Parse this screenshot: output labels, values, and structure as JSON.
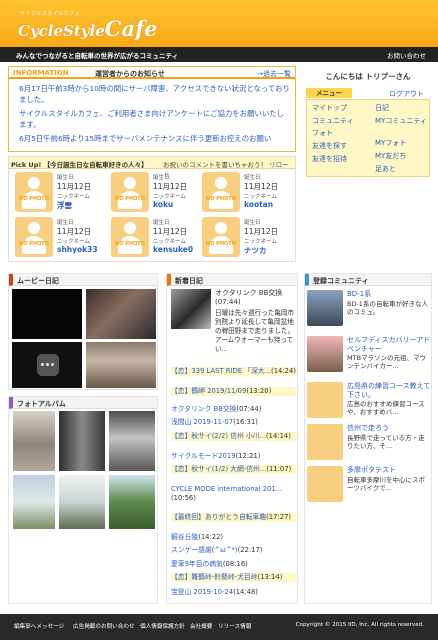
{
  "header": {
    "logo_small": "サイクルスタイルカフェ",
    "logo_main": "CycleStyle",
    "logo_cafe": "Cafe",
    "tagline": "みんなでつながると自転車の世界が広がるコミュニティ",
    "contact": "お問い合わせ"
  },
  "info": {
    "title_en": "INFORMATION",
    "title_ja": "運営者からのお知らせ",
    "past": "→過去一覧",
    "items": [
      "6月17日午前3時から10時の間にサーバ障害、アクセスできない状況となっておりました。",
      "サイクルスタイルカフェ、ご利用者さま向けアンケートにご協力をお願いいたします。",
      "6月5日午前6時より15時までサーバメンテナンスに伴う更新お控えのお願い"
    ]
  },
  "pickup": {
    "title": "Pick Up! 【今日誕生日な自転車好きの人々】",
    "bang": "お祝いのコメントを書いちゃおう！",
    "reload": "リロード",
    "birthday_label": "誕生日",
    "nickname_label": "ニックネーム",
    "no_photo": "NO PHOTO",
    "people": [
      {
        "date": "11月12日",
        "name": "浮雲"
      },
      {
        "date": "11月12日",
        "name": "koku"
      },
      {
        "date": "11月12日",
        "name": "kootan"
      },
      {
        "date": "11月12日",
        "name": "shhyok33"
      },
      {
        "date": "11月12日",
        "name": "kensuke0"
      },
      {
        "date": "11月12日",
        "name": "ナツカ"
      }
    ]
  },
  "sidebar": {
    "greeting": "こんにちは トリプーさん",
    "menu_label": "メニュー",
    "logout": "ログアウト",
    "left": [
      "マイトップ",
      "コミュニティ",
      "フォト",
      "友達を探す",
      "友達を招待"
    ],
    "right": [
      "日記",
      "MYコミュニティ",
      "MYフォト",
      "MY友だち",
      "足あと"
    ]
  },
  "movie": {
    "title": "ムービー日記"
  },
  "photo": {
    "title": "フォトアルバム"
  },
  "diary": {
    "title": "新着日記",
    "feature_title": "オクタリンク BB交換(07:44)",
    "feature_text": "日曜は先々週行った亀岡市別院より延長して亀岡盆地の稗田野まで走りました。アームウオーマーも持ってい...",
    "entries": [
      {
        "prefix": "【恋】",
        "text": "339 LAST RIDE 「深大...",
        "time": "(14:24)"
      },
      {
        "prefix": "【恋】",
        "text": "鶴岬 2019/11/09",
        "time": "(13:20)"
      },
      {
        "prefix": "",
        "text": "オクタリンク BB交換",
        "time": "(07:44)"
      },
      {
        "prefix": "",
        "text": "浅間山 2019-11-07",
        "time": "(16:31)"
      },
      {
        "prefix": "【恋】",
        "text": "秋サイ(2/2) 信州 小川...",
        "time": "(14:14)"
      },
      {
        "prefix": "",
        "text": "サイクルモード2019",
        "time": "(12:21)"
      },
      {
        "prefix": "【恋】",
        "text": "秋サイ(1/2) 大網-信州...",
        "time": "(11:07)"
      },
      {
        "prefix": "",
        "text": "CYCLE MODE international 201...",
        "time": "(10:56)"
      },
      {
        "prefix": "【最終回】",
        "text": "ありがとう自転車趣",
        "time": "(17:27)"
      },
      {
        "prefix": "",
        "text": "観谷丘陵",
        "time": "(14:22)"
      },
      {
        "prefix": "",
        "text": "スンゲー感謝(^ω^*)",
        "time": "(22:17)"
      },
      {
        "prefix": "",
        "text": "愛車9年目の病気",
        "time": "(08:16)"
      },
      {
        "prefix": "【恋】",
        "text": "難鶴峠-鈴懸峠-犬目峠",
        "time": "(13:14)"
      },
      {
        "prefix": "",
        "text": "宝登山 2019-10-24",
        "time": "(14:48)"
      }
    ]
  },
  "community": {
    "title": "登録コミュニティ",
    "items": [
      {
        "name": "BD-1系",
        "desc": "BD-1系の自転車が好きな人のコミュ。"
      },
      {
        "name": "セルフディスカバリーアドベンチャー",
        "desc": "MTBマラソンの元祖、マウンテンバイカー..."
      },
      {
        "name": "広島県の練習コース教えて下さい。",
        "desc": "広島のおすすめ練習コースや、おすすめバ..."
      },
      {
        "name": "信州で走ろう",
        "desc": "長野県で走っている方・走りたい方、そ..."
      },
      {
        "name": "多摩ポタテスト",
        "desc": "自転車多摩川を中心にスポーツバイクで..."
      }
    ]
  },
  "footer": {
    "links": [
      "編集部へメッセージ",
      "広告掲載のお問い合わせ",
      "個人情報保護方針",
      "会社概要",
      "リリース情報"
    ],
    "copyright": "Copyright © 2015 IID, Inc. All rights reserved."
  },
  "colors": {
    "brand_orange": "#f6a10f",
    "link_blue": "#2a5cc2",
    "menu_yellow": "#fff8c6",
    "footer_dark": "#2a2a2a"
  }
}
